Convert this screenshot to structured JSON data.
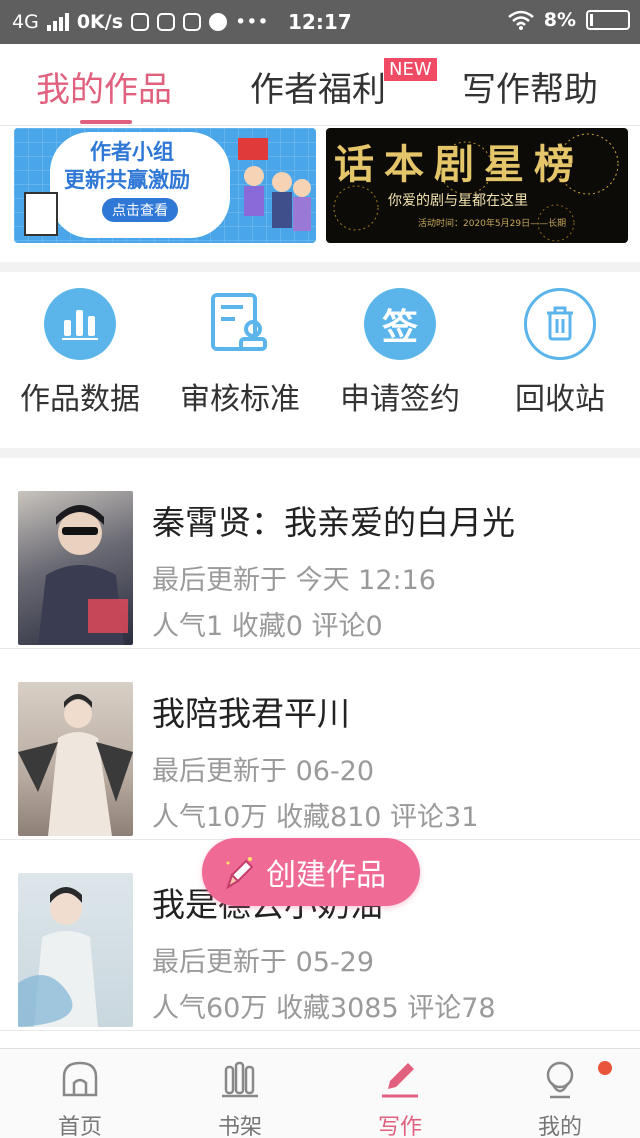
{
  "status_bar": {
    "network": "4G",
    "speed": "0K/s",
    "more": "•••",
    "time": "12:17",
    "battery": "8%"
  },
  "tabs": [
    {
      "label": "我的作品",
      "active": true
    },
    {
      "label": "作者福利",
      "active": false,
      "badge": "NEW"
    },
    {
      "label": "写作帮助",
      "active": false
    }
  ],
  "banners": [
    {
      "title_line1": "作者小组",
      "title_line2": "更新共赢激励",
      "button": "点击查看"
    },
    {
      "title": "话本剧星榜",
      "subtitle": "你爱的剧与星都在这里",
      "date": "活动时间：2020年5月29日——长期"
    }
  ],
  "quick_actions": [
    {
      "label": "作品数据",
      "icon": "bar-chart-icon"
    },
    {
      "label": "审核标准",
      "icon": "review-document-icon"
    },
    {
      "label": "申请签约",
      "icon": "sign-contract-icon"
    },
    {
      "label": "回收站",
      "icon": "trash-icon"
    }
  ],
  "works": [
    {
      "title": "秦霄贤：我亲爱的白月光",
      "updated": "最后更新于 今天 12:16",
      "stats": "人气1 收藏0 评论0"
    },
    {
      "title": "我陪我君平川",
      "updated": "最后更新于 06-20",
      "stats": "人气10万 收藏810 评论31"
    },
    {
      "title": "我是德云小奶油",
      "updated": "最后更新于 05-29",
      "stats": "人气60万 收藏3085 评论78"
    }
  ],
  "fab": {
    "label": "创建作品",
    "icon": "pencil-icon"
  },
  "bottom_nav": [
    {
      "label": "首页",
      "icon": "home-icon"
    },
    {
      "label": "书架",
      "icon": "bookshelf-icon"
    },
    {
      "label": "写作",
      "icon": "write-icon",
      "active": true
    },
    {
      "label": "我的",
      "icon": "profile-icon",
      "notification": true
    }
  ],
  "colors": {
    "accent": "#e0607e",
    "fab": "#f06a96",
    "icon_blue": "#5bb5ea",
    "badge": "#f04a64"
  }
}
